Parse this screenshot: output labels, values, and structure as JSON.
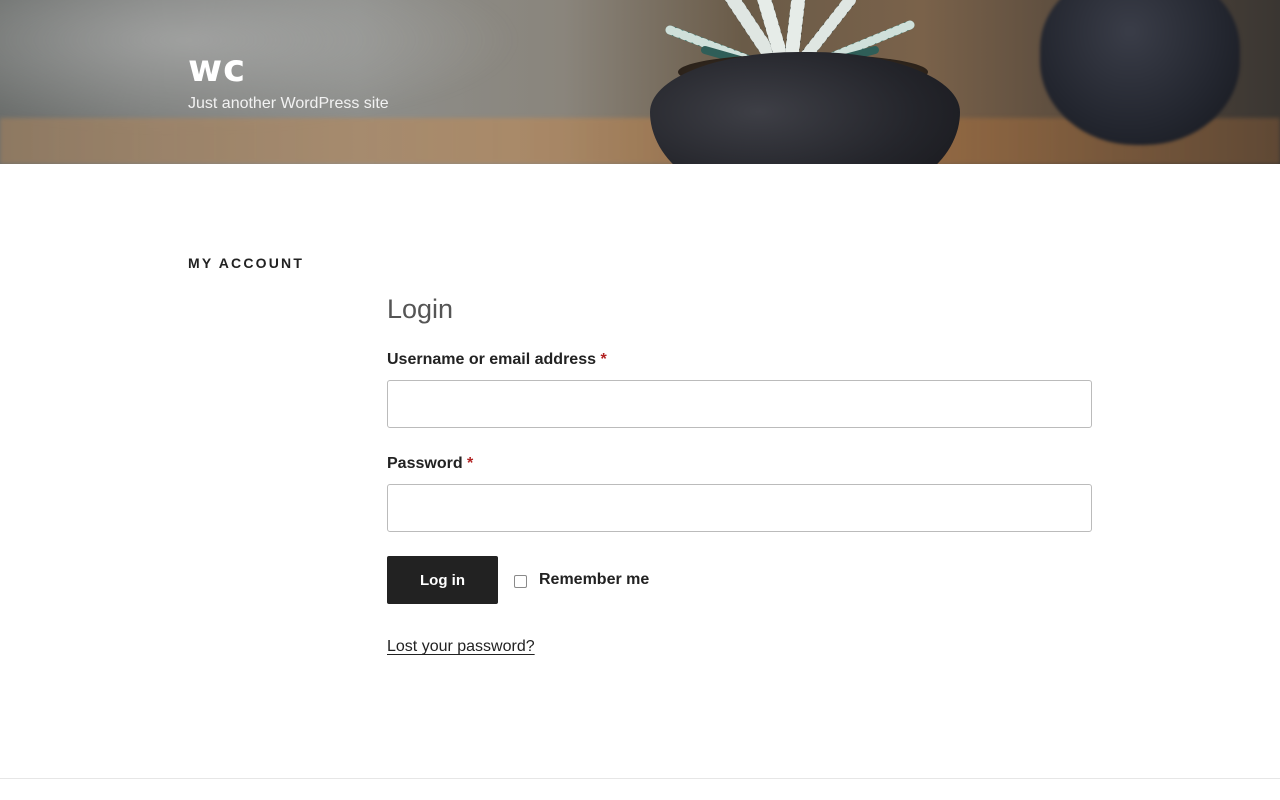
{
  "site": {
    "title": "wc",
    "description": "Just another WordPress site"
  },
  "page": {
    "title": "MY ACCOUNT"
  },
  "login": {
    "heading": "Login",
    "username_label": "Username or email address",
    "password_label": "Password",
    "required_mark": "*",
    "submit_label": "Log in",
    "remember_label": "Remember me",
    "remember_checked": false,
    "lost_password_label": "Lost your password?"
  },
  "colors": {
    "text": "#222222",
    "button_bg": "#222222",
    "required": "#b22222",
    "heading": "#555555"
  }
}
